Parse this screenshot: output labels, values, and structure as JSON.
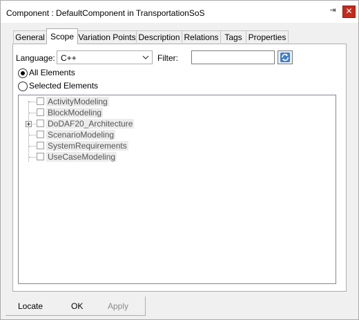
{
  "window": {
    "title": "Component : DefaultComponent in TransportationSoS",
    "pin_glyph": "⇥",
    "close_glyph": "✕"
  },
  "tabs": [
    {
      "label": "General",
      "active": false
    },
    {
      "label": "Scope",
      "active": true
    },
    {
      "label": "Variation Points",
      "active": false
    },
    {
      "label": "Description",
      "active": false
    },
    {
      "label": "Relations",
      "active": false
    },
    {
      "label": "Tags",
      "active": false
    },
    {
      "label": "Properties",
      "active": false
    }
  ],
  "scope": {
    "language_label": "Language:",
    "language_value": "C++",
    "filter_label": "Filter:",
    "filter_value": "",
    "radio_all": "All Elements",
    "radio_selected": "Selected Elements",
    "selected_radio": "all"
  },
  "tree_items": [
    {
      "label": "ActivityModeling",
      "expandable": false
    },
    {
      "label": "BlockModeling",
      "expandable": false
    },
    {
      "label": "DoDAF20_Architecture",
      "expandable": true
    },
    {
      "label": "ScenarioModeling",
      "expandable": false
    },
    {
      "label": "SystemRequirements",
      "expandable": false
    },
    {
      "label": "UseCaseModeling",
      "expandable": false
    }
  ],
  "buttons": {
    "locate": "Locate",
    "ok": "OK",
    "apply": "Apply"
  },
  "icons": {
    "pin": "pin-icon",
    "close": "close-icon",
    "dropdown": "chevron-down-icon",
    "refresh": "refresh-icon",
    "expand": "plus-icon"
  },
  "colors": {
    "close_button": "#c42b1c",
    "dialog_background": "#f0f0f0",
    "tree_label_highlight": "#ececec"
  }
}
